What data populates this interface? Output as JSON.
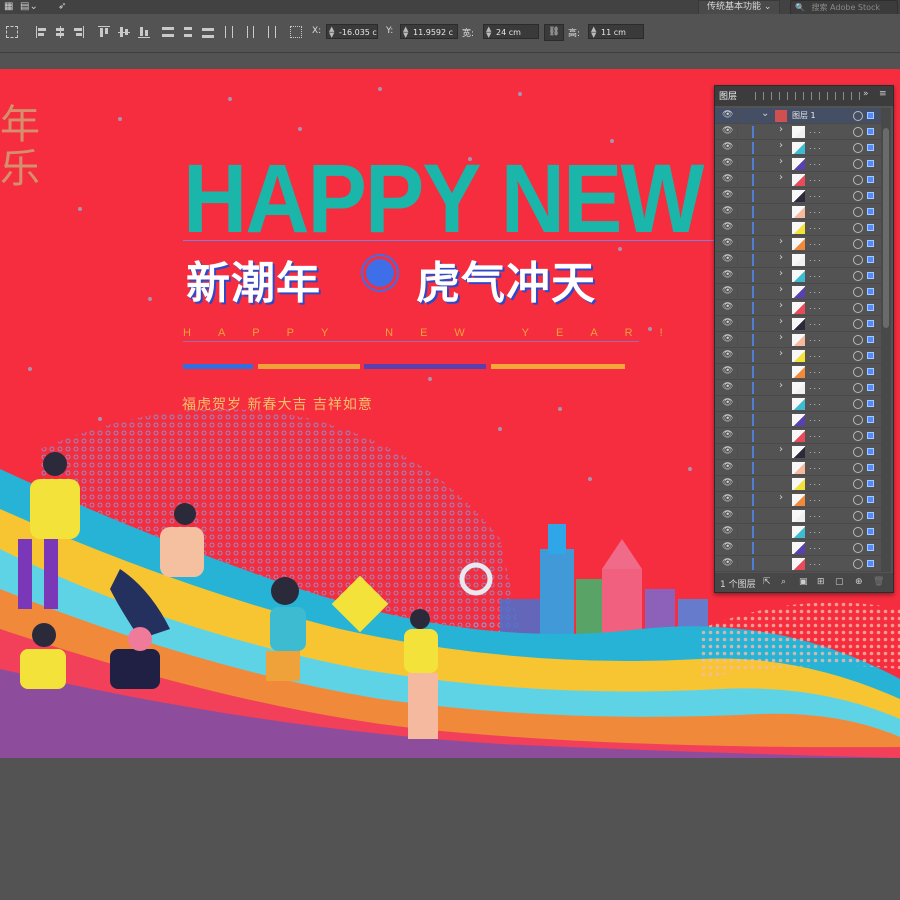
{
  "menubar": {
    "workspace_label": "传统基本功能",
    "workspace_caret": "⌄",
    "search_placeholder": "搜索 Adobe Stock"
  },
  "control_bar": {
    "x_label": "X:",
    "x_value": "-16.035 c",
    "y_label": "Y:",
    "y_value": "11.9592 c",
    "width_label": "宽:",
    "width_value": "24 cm",
    "height_label": "高:",
    "height_value": "11 cm"
  },
  "artwork": {
    "side_chars": "年乐",
    "headline": "HAPPY NEW Y",
    "cn_left": "新潮年",
    "cn_right": "虎气冲天",
    "spaced_subtitle": "HAPPY NEW YEAR!",
    "blessing": "福虎贺岁 新春大吉 吉祥如意",
    "colors": {
      "background": "#f52d3f",
      "headline": "#1ab6aa",
      "stripe_blue": "#2f6fe0",
      "stripe_orange": "#f0a23a",
      "stripe_purple": "#5a3fb0",
      "stripe_amber": "#f4a83a"
    }
  },
  "layers_panel": {
    "tab_label": "图层",
    "collapse_icon": "»",
    "menu_icon": "≡",
    "top_layer_name": "图层 1",
    "row_name": "...",
    "row_count": 28,
    "footer_count": "1 个图层"
  }
}
